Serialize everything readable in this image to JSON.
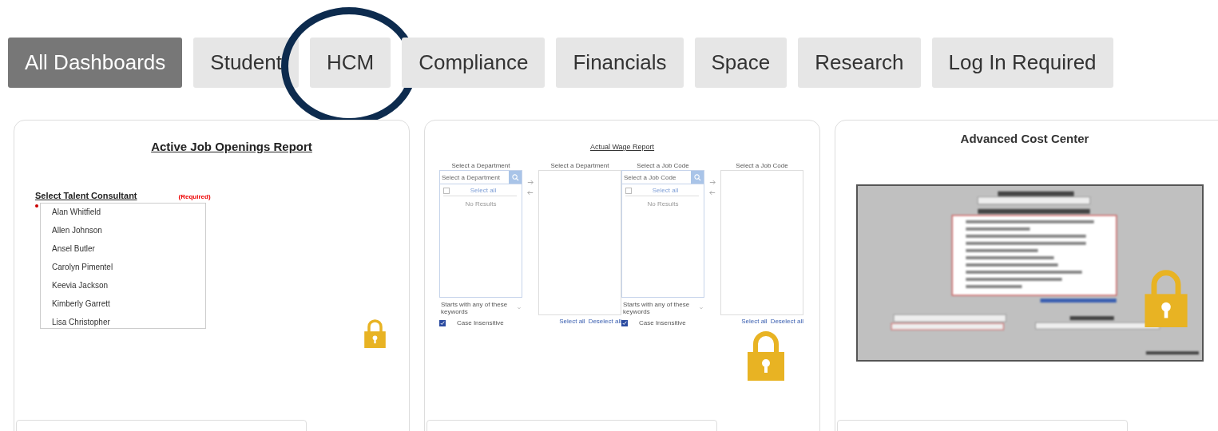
{
  "tabs": [
    {
      "label": "All Dashboards",
      "selected": true,
      "circled": false
    },
    {
      "label": "Student",
      "selected": false,
      "circled": false
    },
    {
      "label": "HCM",
      "selected": false,
      "circled": true
    },
    {
      "label": "Compliance",
      "selected": false,
      "circled": false
    },
    {
      "label": "Financials",
      "selected": false,
      "circled": false
    },
    {
      "label": "Space",
      "selected": false,
      "circled": false
    },
    {
      "label": "Research",
      "selected": false,
      "circled": false
    },
    {
      "label": "Log In Required",
      "selected": false,
      "circled": false
    }
  ],
  "cards": [
    {
      "kind": "consultant_list",
      "title": "Active Job Openings Report",
      "field_label": "Select Talent Consultant",
      "required_note": "(Required)",
      "options": [
        "Alan Whitfield",
        "Allen Johnson",
        "Ansel Butler",
        "Carolyn Pimentel",
        "Keevia Jackson",
        "Kimberly Garrett",
        "Lisa Christopher"
      ],
      "locked": true
    },
    {
      "kind": "dual_list",
      "title": "Actual Wage Report",
      "pickers": [
        {
          "label": "Select a Department",
          "placeholder": "Select a Department",
          "select_all": "Select all",
          "select_all_checked": false,
          "empty_text": "No Results",
          "match_mode": "Starts with any of these keywords",
          "case_label": "Case Insensitive",
          "case_checked": true,
          "target_label": "Select a Department",
          "target_links": [
            "Select all",
            "Deselect all"
          ]
        },
        {
          "label": "Select a Job Code",
          "placeholder": "Select a Job Code",
          "select_all": "Select all",
          "select_all_checked": false,
          "empty_text": "No Results",
          "match_mode": "Starts with any of these keywords",
          "case_label": "Case Insensitive",
          "case_checked": true,
          "target_label": "Select a Job Code",
          "target_links": [
            "Select all",
            "Deselect all"
          ]
        }
      ],
      "locked": true
    },
    {
      "kind": "preview",
      "title": "Advanced Cost Center",
      "locked": true
    }
  ]
}
